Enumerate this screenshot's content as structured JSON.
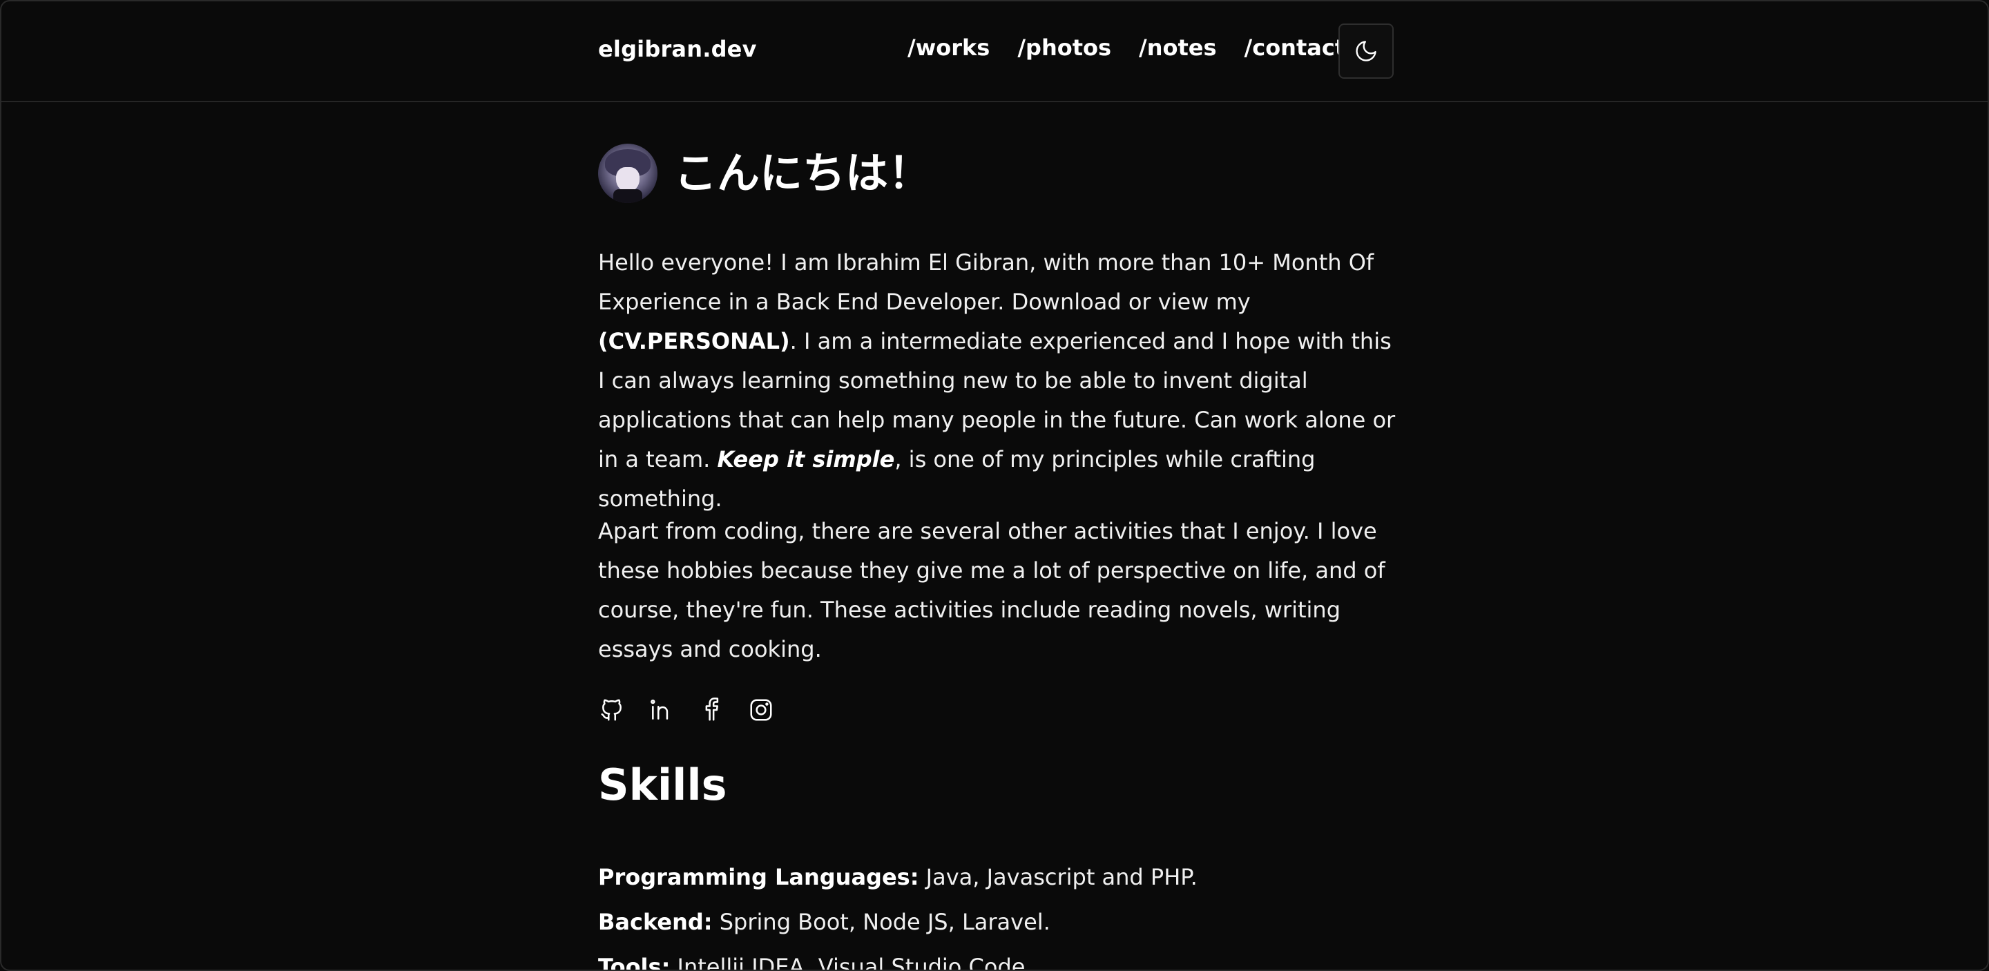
{
  "header": {
    "brand": "elgibran.dev",
    "nav": [
      "/works",
      "/photos",
      "/notes",
      "/contact"
    ],
    "theme_toggle_icon": "moon-icon"
  },
  "hero": {
    "greeting": "こんにちは！",
    "avatar": "avatar-image"
  },
  "about": {
    "p1_a": "Hello everyone! I am Ibrahim El Gibran, with more than 10+ Month Of Experience in a Back End Developer. Download or view my ",
    "p1_cv": "(CV.PERSONAL)",
    "p1_b": ". I am a intermediate experienced and I hope with this I can always learning something new to be able to invent digital applications that can help many people in the future. Can work alone or in a team. ",
    "p1_motto": "Keep it simple",
    "p1_c": ", is one of my principles while crafting something.",
    "p2": "Apart from coding, there are several other activities that I enjoy. I love these hobbies because they give me a lot of perspective on life, and of course, they're fun. These activities include reading novels, writing essays and cooking."
  },
  "socials": [
    "github-icon",
    "linkedin-icon",
    "facebook-icon",
    "instagram-icon"
  ],
  "skills": {
    "title": "Skills",
    "items": [
      {
        "label": "Programming Languages:",
        "value": " Java, Javascript and PHP."
      },
      {
        "label": "Backend:",
        "value": " Spring Boot, Node JS, Laravel."
      },
      {
        "label": "Tools:",
        "value": " Intellij IDEA, Visual Studio Code."
      }
    ]
  },
  "colors": {
    "background": "#0a0a0a",
    "text": "#f0f0f0",
    "border": "#262626"
  }
}
